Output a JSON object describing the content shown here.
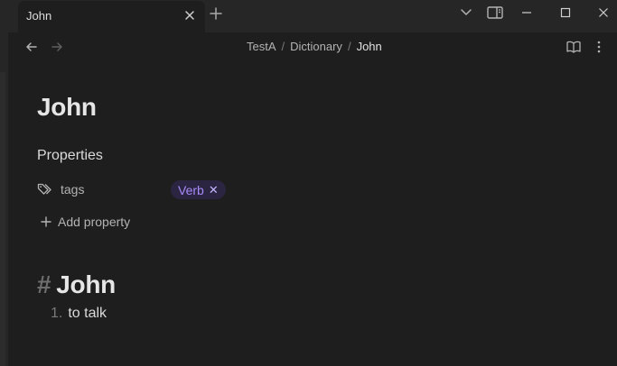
{
  "tab": {
    "title": "John"
  },
  "breadcrumb": {
    "items": [
      "TestA",
      "Dictionary",
      "John"
    ],
    "separator": "/"
  },
  "note": {
    "title": "John",
    "properties_heading": "Properties",
    "property": {
      "key": "tags",
      "tag": "Verb"
    },
    "add_property_label": "Add property",
    "heading_marker": "#",
    "heading": "John",
    "list": [
      {
        "number": "1.",
        "text": "to talk"
      }
    ]
  },
  "icons": {
    "tab_close": "close-icon",
    "new_tab": "plus-icon",
    "tab_list": "chevron-down-icon",
    "sidebar_toggle": "sidebar-toggle-icon",
    "minimize": "minimize-icon",
    "maximize": "maximize-icon",
    "close_window": "close-icon",
    "back": "arrow-left-icon",
    "forward": "arrow-right-icon",
    "reading_view": "book-open-icon",
    "more_options": "more-vertical-icon",
    "property_type": "tags-icon",
    "add": "plus-icon"
  },
  "colors": {
    "tag_text": "#a78bfa",
    "tag_bg": "#2c2541",
    "background": "#1e1e1e"
  }
}
